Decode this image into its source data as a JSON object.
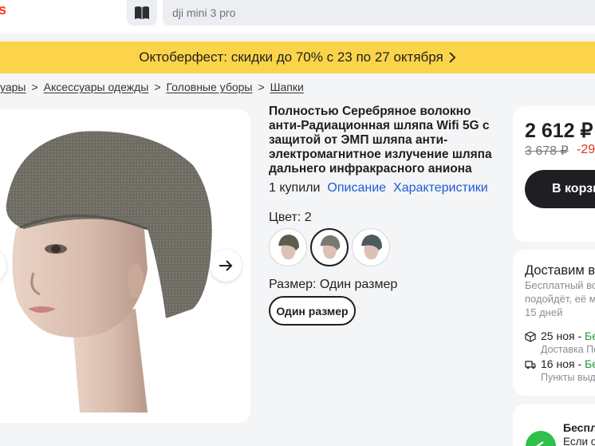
{
  "header": {
    "logo_fragment": "s",
    "search": {
      "placeholder": "dji mini 3 pro"
    },
    "catalog_icon": "book-icon"
  },
  "promo_banner": {
    "text": "Октоберфест: скидки до 70% с 23 по 27 октября",
    "arrow_icon": "chevron-right-icon",
    "color": "#fbd449"
  },
  "breadcrumbs": [
    "ссуары",
    "Аксессуары одежды",
    "Головные уборы",
    "Шапки"
  ],
  "product": {
    "title": "Полностью Серебряное волокно анти-Радиационная шляпа Wifi 5G с защитой от ЭМП шляпа анти-электромагнитное излучение шляпа дальнего инфракрасного аниона",
    "bought": "1 купили",
    "description_link": "Описание",
    "specs_link": "Характеристики",
    "color_label": "Цвет: 2",
    "size_label": "Размер: Один размер",
    "size_option": "Один размер",
    "swatches": [
      "dark-olive",
      "grey-selected",
      "blue-grey"
    ]
  },
  "price_card": {
    "price": "2 612 ₽",
    "old_price": "3 678 ₽",
    "discount": "-29",
    "cart_button": "В корзи",
    "accent_color": "#1f1f23"
  },
  "delivery": {
    "title": "Доставим в",
    "note_lines": [
      "Бесплатный воз",
      "подойдёт, её ме",
      "15 дней"
    ],
    "rows": [
      {
        "date": "25 ноя -",
        "free": "Бес",
        "sub": "Доставка По",
        "icon": "box-icon"
      },
      {
        "date": "16 ноя -",
        "free": "Бес",
        "sub": "Пункты выд",
        "icon": "truck-icon"
      }
    ],
    "free_color": "#1f9d3a"
  },
  "promo_card": {
    "line1": "Беспла",
    "line2": "Если о",
    "badge_color": "#2fbf4a"
  }
}
